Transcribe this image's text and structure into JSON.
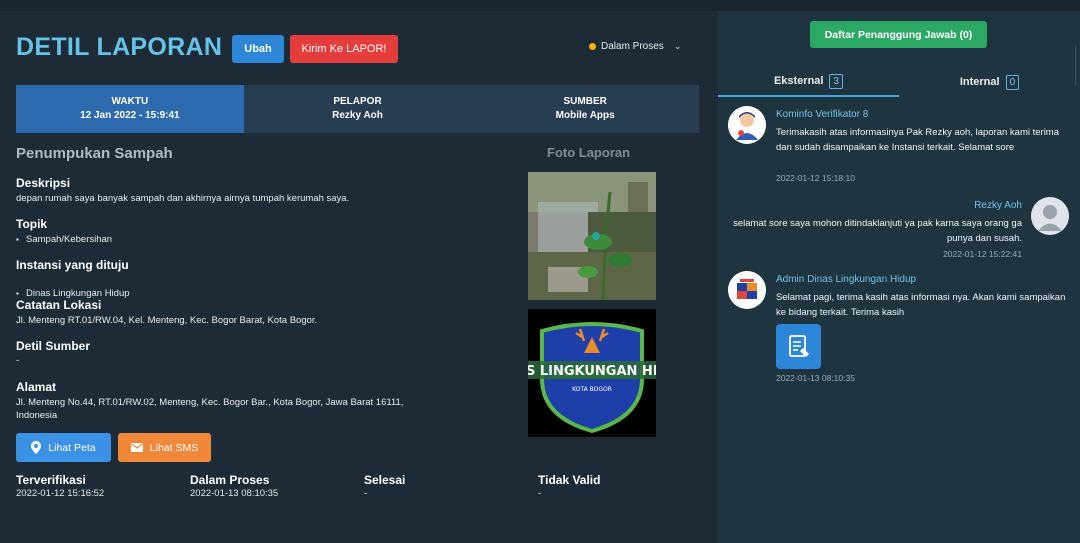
{
  "header": {
    "title": "DETIL LAPORAN",
    "edit_label": "Ubah",
    "send_label": "Kirim Ke LAPOR!",
    "status_label": "Dalam Proses"
  },
  "info": {
    "cells": [
      {
        "label": "WAKTU",
        "value": "12 Jan 2022 - 15:9:41"
      },
      {
        "label": "PELAPOR",
        "value": "Rezky Aoh"
      },
      {
        "label": "SUMBER",
        "value": "Mobile Apps"
      }
    ]
  },
  "report": {
    "subject": "Penumpukan Sampah",
    "photo_label": "Foto Laporan",
    "description_label": "Deskripsi",
    "description": "depan rumah saya banyak sampah dan akhirnya airnya tumpah kerumah saya.",
    "topic_label": "Topik",
    "topic": "Sampah/Kebersihan",
    "agency_label": "Instansi yang dituju",
    "agency": "Dinas Lingkungan Hidup",
    "location_label": "Catatan Lokasi",
    "location": "Jl. Menteng RT.01/RW.04, Kel. Menteng, Kec. Bogor Barat, Kota Bogor.",
    "source_detail_label": "Detil Sumber",
    "source_detail": "-",
    "address_label": "Alamat",
    "address": "Jl. Menteng No.44, RT.01/RW.02, Menteng, Kec. Bogor Bar., Kota Bogor, Jawa Barat 16111, Indonesia",
    "logo_text": "DINAS LINGKUNGAN HIDUP",
    "logo_subtext": "KOTA BOGOR"
  },
  "actions": {
    "map_label": "Lihat Peta",
    "sms_label": "Lihat SMS"
  },
  "statuses": [
    {
      "label": "Terverifikasi",
      "value": "2022-01-12 15:16:52"
    },
    {
      "label": "Dalam Proses",
      "value": "2022-01-13 08:10:35"
    },
    {
      "label": "Selesai",
      "value": "-"
    },
    {
      "label": "Tidak Valid",
      "value": "-"
    }
  ],
  "sidebar": {
    "responsible_button": "Daftar Penanggung Jawab (0)",
    "tabs": [
      {
        "label": "Eksternal",
        "count": "3"
      },
      {
        "label": "Internal",
        "count": "0"
      }
    ],
    "messages": [
      {
        "name": "Kominfo Verifikator 8",
        "text": "Terimakasih atas informasinya Pak Rezky aoh, laporan kami terima dan sudah disampaikan ke Instansi terkait. Selamat sore",
        "time": "2022-01-12 15:18:10"
      },
      {
        "name": "Rezky Aoh",
        "text": "selamat sore saya mohon ditindaklanjuti ya pak karna saya orang ga punya dan susah.",
        "time": "2022-01-12 15:22:41"
      },
      {
        "name": "Admin Dinas Lingkungan Hidup",
        "text": "Selamat pagi, terima kasih atas informasi nya. Akan kami sampaikan ke bidang terkait. Terima kasih",
        "time": "2022-01-13 08:10:35"
      }
    ]
  },
  "colors": {
    "title": "#66c2e9",
    "accent_blue": "#2e86d9",
    "danger": "#e53c3c",
    "success": "#2ca865",
    "warning": "#f0883a",
    "status_dot": "#f5b500"
  }
}
